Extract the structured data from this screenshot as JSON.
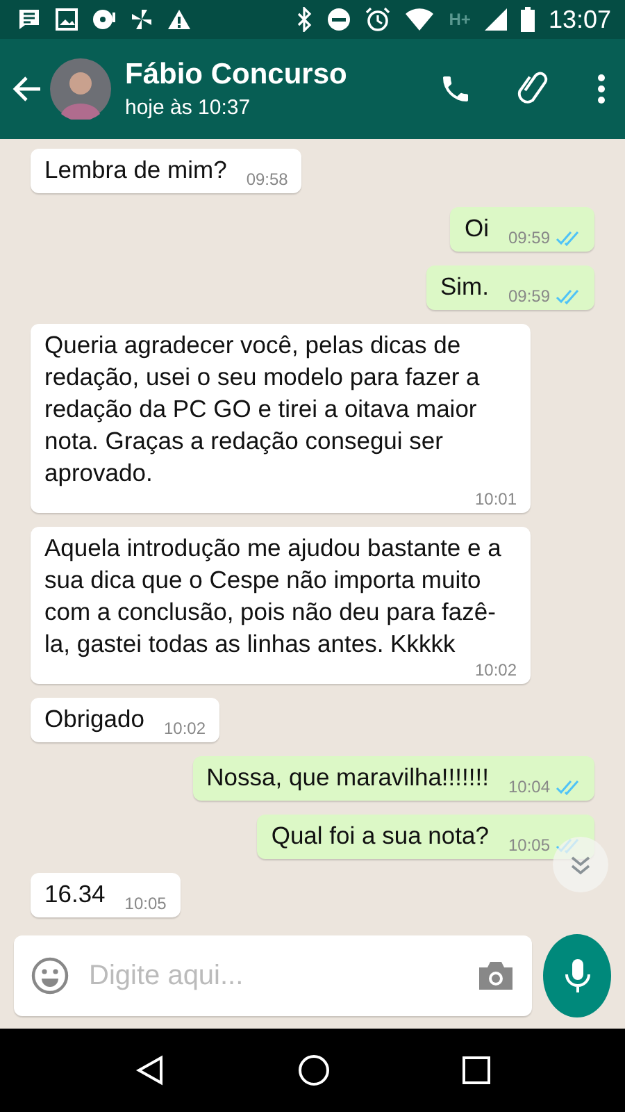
{
  "status_bar": {
    "time": "13:07",
    "network": "H+"
  },
  "header": {
    "name": "Fábio Concurso",
    "last_seen": "hoje às 10:37"
  },
  "messages": [
    {
      "kind": "in",
      "text": "Lembra de mim?",
      "time": "09:58"
    },
    {
      "kind": "out",
      "text": "Oi",
      "time": "09:59",
      "read": true
    },
    {
      "kind": "out",
      "text": "Sim.",
      "time": "09:59",
      "read": true
    },
    {
      "kind": "in",
      "text": "Queria agradecer você, pelas dicas de redação, usei o seu modelo para fazer a redação da PC GO e tirei a oitava maior nota. Graças a redação consegui ser aprovado.",
      "time": "10:01"
    },
    {
      "kind": "in",
      "text": "Aquela introdução me ajudou bastante e a sua dica que o Cespe não importa muito com a conclusão, pois não deu para fazê-la, gastei todas as linhas antes. Kkkkk",
      "time": "10:02"
    },
    {
      "kind": "in",
      "text": "Obrigado",
      "time": "10:02"
    },
    {
      "kind": "out",
      "text": "Nossa, que maravilha!!!!!!!",
      "time": "10:04",
      "read": true
    },
    {
      "kind": "out",
      "text": "Qual foi a sua nota?",
      "time": "10:05",
      "read": true
    },
    {
      "kind": "in",
      "text": "16.34",
      "time": "10:05"
    }
  ],
  "composer": {
    "placeholder": "Digite aqui..."
  }
}
